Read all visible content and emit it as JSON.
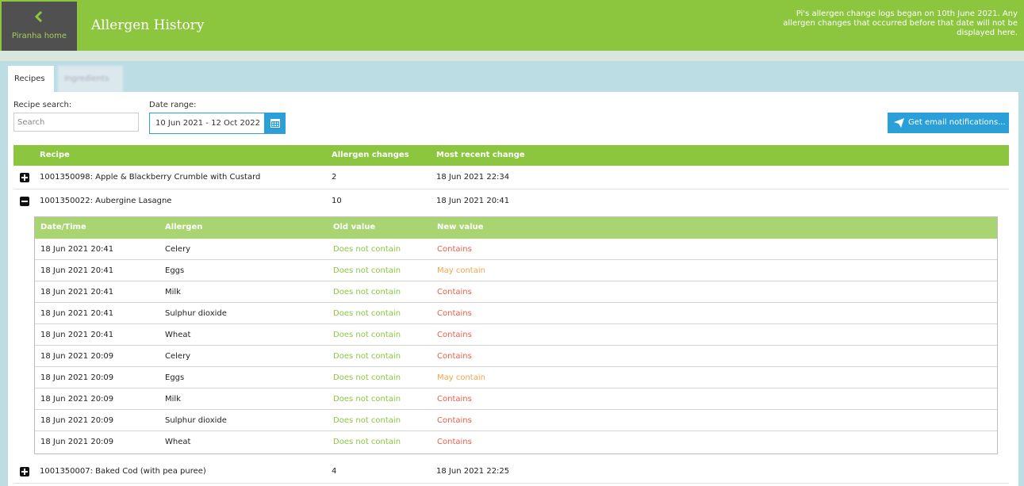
{
  "header": {
    "home_label": "Piranha home",
    "title": "Allergen History",
    "notice": "Pi's allergen change logs began on 10th June 2021. Any allergen changes that occurred before that date will not be displayed here."
  },
  "tabs": [
    {
      "label": "Recipes",
      "active": true
    },
    {
      "label": "Ingredients",
      "active": false
    }
  ],
  "filters": {
    "search_label": "Recipe search:",
    "search_placeholder": "Search",
    "date_label": "Date range:",
    "date_value": "10 Jun 2021 - 12 Oct 2022",
    "notify_label": "Get email notifications..."
  },
  "table": {
    "headers": [
      "Recipe",
      "Allergen changes",
      "Most recent change"
    ],
    "rows": [
      {
        "recipe": "1001350098: Apple & Blackberry Crumble with Custard",
        "changes": "2",
        "recent": "18 Jun 2021 22:34",
        "expanded": false
      },
      {
        "recipe": "1001350022: Aubergine Lasagne",
        "changes": "10",
        "recent": "18 Jun 2021 20:41",
        "expanded": true
      },
      {
        "recipe": "1001350007: Baked Cod (with pea puree)",
        "changes": "4",
        "recent": "18 Jun 2021 22:25",
        "expanded": false
      }
    ]
  },
  "details": {
    "headers": [
      "Date/Time",
      "Allergen",
      "Old value",
      "New value"
    ],
    "rows": [
      {
        "datetime": "18 Jun 2021 20:41",
        "allergen": "Celery",
        "old": "Does not contain",
        "new": "Contains"
      },
      {
        "datetime": "18 Jun 2021 20:41",
        "allergen": "Eggs",
        "old": "Does not contain",
        "new": "May contain"
      },
      {
        "datetime": "18 Jun 2021 20:41",
        "allergen": "Milk",
        "old": "Does not contain",
        "new": "Contains"
      },
      {
        "datetime": "18 Jun 2021 20:41",
        "allergen": "Sulphur dioxide",
        "old": "Does not contain",
        "new": "Contains"
      },
      {
        "datetime": "18 Jun 2021 20:41",
        "allergen": "Wheat",
        "old": "Does not contain",
        "new": "Contains"
      },
      {
        "datetime": "18 Jun 2021 20:09",
        "allergen": "Celery",
        "old": "Does not contain",
        "new": "Contains"
      },
      {
        "datetime": "18 Jun 2021 20:09",
        "allergen": "Eggs",
        "old": "Does not contain",
        "new": "May contain"
      },
      {
        "datetime": "18 Jun 2021 20:09",
        "allergen": "Milk",
        "old": "Does not contain",
        "new": "Contains"
      },
      {
        "datetime": "18 Jun 2021 20:09",
        "allergen": "Sulphur dioxide",
        "old": "Does not contain",
        "new": "Contains"
      },
      {
        "datetime": "18 Jun 2021 20:09",
        "allergen": "Wheat",
        "old": "Does not contain",
        "new": "Contains"
      }
    ]
  },
  "colors": {
    "brand_green": "#8cc63f",
    "accent_blue": "#2b9fd8",
    "contains_red": "#e8604c",
    "may_contain_orange": "#f5a54a"
  }
}
